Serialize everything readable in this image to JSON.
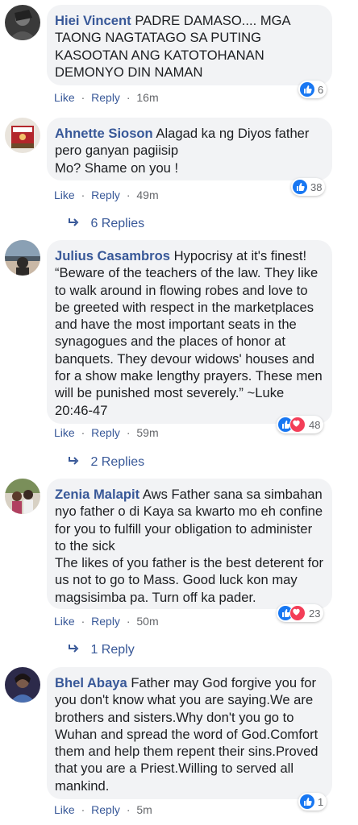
{
  "comments": [
    {
      "author": "Hiei Vincent",
      "text": "PADRE DAMASO.... MGA TAONG NAGTATAGO SA PUTING KASOOTAN ANG KATOTOHANAN DEMONYO DIN NAMAN",
      "reaction_count": "6",
      "reactions": [
        "like"
      ],
      "like_label": "Like",
      "reply_label": "Reply",
      "time": "16m"
    },
    {
      "author": "Ahnette Sioson",
      "text": "Alagad ka ng Diyos father pero ganyan pagiisip\nMo? Shame on you !",
      "reaction_count": "38",
      "reactions": [
        "like"
      ],
      "like_label": "Like",
      "reply_label": "Reply",
      "time": "49m",
      "replies": "6 Replies"
    },
    {
      "author": "Julius Casambros",
      "text": "Hypocrisy at it's finest! “Beware of the teachers of the law. They like to walk around in flowing robes and love to be greeted with respect in the marketplaces and have the most important seats in the synagogues and the places of honor at banquets. They devour widows' houses and for a show make lengthy prayers. These men will be punished most severely.” ~Luke 20:46-47",
      "reaction_count": "48",
      "reactions": [
        "like",
        "love"
      ],
      "like_label": "Like",
      "reply_label": "Reply",
      "time": "59m",
      "replies": "2 Replies"
    },
    {
      "author": "Zenia Malapit",
      "text": "Aws Father sana sa simbahan nyo father o di Kaya sa kwarto mo eh confine for you to fulfill your obligation to administer to the sick\nThe likes of you father is the best deterent for us not to go to Mass. Good luck kon may magsisimba pa. Turn off ka pader.",
      "reaction_count": "23",
      "reactions": [
        "like",
        "love"
      ],
      "like_label": "Like",
      "reply_label": "Reply",
      "time": "50m",
      "replies": "1 Reply"
    },
    {
      "author": "Bhel Abaya",
      "text": "Father may God forgive you for you don't know what you are saying.We are brothers and sisters.Why don't you go to Wuhan and spread the word of God.Comfort them and help them repent their sins.Proved that you are a Priest.Willing to served all mankind.",
      "reaction_count": "1",
      "reactions": [
        "like"
      ],
      "like_label": "Like",
      "reply_label": "Reply",
      "time": "5m"
    }
  ],
  "separator": "·",
  "colors": {
    "bubble": "#f2f3f5",
    "link": "#385898",
    "meta": "#65676b",
    "like": "#1877f2",
    "love": "#f33e58"
  },
  "icons": {
    "like": "thumbs-up-icon",
    "love": "heart-icon",
    "reply_arrow": "reply-arrow-icon"
  }
}
